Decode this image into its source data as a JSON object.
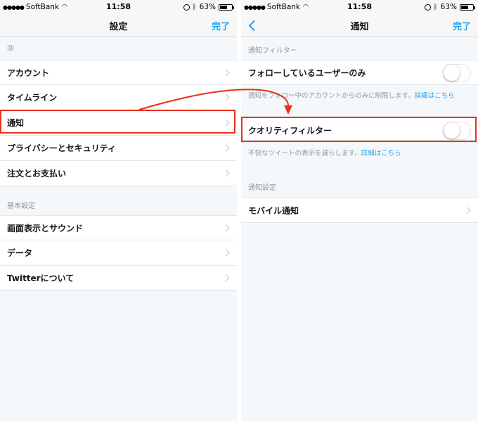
{
  "status_bar": {
    "signal_dots": "●●●●●",
    "carrier": "SoftBank",
    "time": "11:58",
    "battery_text": "63%",
    "battery_level": 0.63
  },
  "left": {
    "title": "設定",
    "done": "完了",
    "section1_header": "@",
    "section1_items": [
      {
        "label": "アカウント"
      },
      {
        "label": "タイムライン"
      },
      {
        "label": "通知"
      },
      {
        "label": "プライバシーとセキュリティ"
      },
      {
        "label": "注文とお支払い"
      }
    ],
    "section2_header": "基本設定",
    "section2_items": [
      {
        "label": "画面表示とサウンド"
      },
      {
        "label": "データ"
      },
      {
        "label": "Twitterについて"
      }
    ]
  },
  "right": {
    "title": "通知",
    "done": "完了",
    "section1_header": "通知フィルター",
    "follow_only_label": "フォローしているユーザーのみ",
    "follow_only_note": "通知をフォロー中のアカウントからのみに制限します。",
    "follow_only_link": "詳細はこちら",
    "quality_filter_label": "クオリティフィルター",
    "quality_filter_note": "不快なツイートの表示を減らします。",
    "quality_filter_link": "詳細はこちら",
    "section2_header": "通知設定",
    "mobile_label": "モバイル通知"
  },
  "colors": {
    "accent": "#1da1f2",
    "highlight": "#e8311a"
  }
}
